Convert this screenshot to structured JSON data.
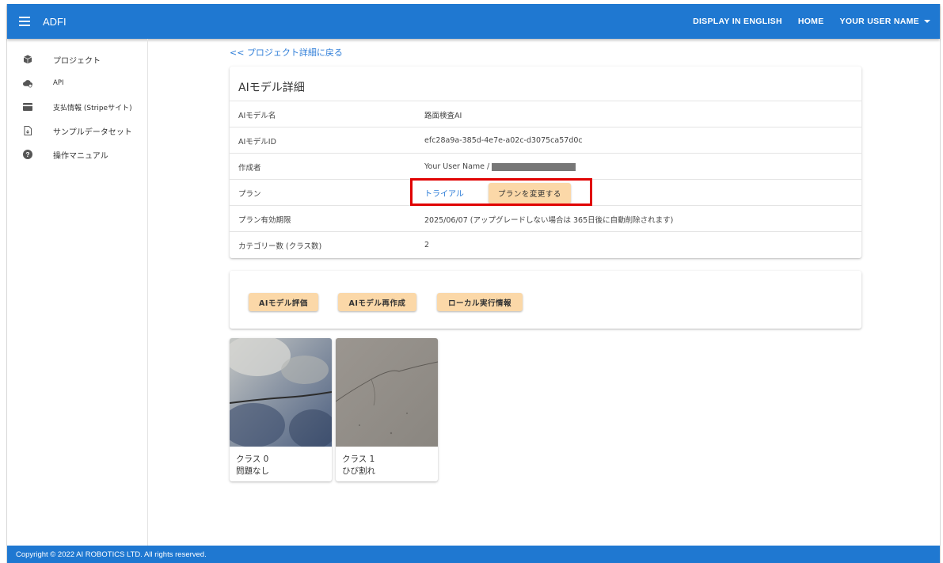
{
  "appbar": {
    "title": "ADFI",
    "lang_link": "DISPLAY IN ENGLISH",
    "home_link": "HOME",
    "user_menu": "YOUR USER NAME"
  },
  "sidebar": {
    "items": [
      {
        "label": "プロジェクト",
        "icon": "cube-icon"
      },
      {
        "label": "API",
        "icon": "cloud-api-icon"
      },
      {
        "label": "支払情報 (Stripeサイト)",
        "icon": "credit-card-icon"
      },
      {
        "label": "サンプルデータセット",
        "icon": "file-download-icon"
      },
      {
        "label": "操作マニュアル",
        "icon": "help-circle-icon"
      }
    ]
  },
  "back_link": "<< プロジェクト詳細に戻る",
  "detail": {
    "title": "AIモデル詳細",
    "rows": [
      {
        "label": "AIモデル名",
        "value": "路面検査AI"
      },
      {
        "label": "AIモデルID",
        "value": "efc28a9a-385d-4e7e-a02c-d3075ca57d0c"
      },
      {
        "label": "作成者",
        "value": "Your User Name /"
      },
      {
        "label": "プラン",
        "value": "トライアル",
        "button": "プランを変更する"
      },
      {
        "label": "プラン有効期限",
        "value": "2025/06/07 (アップグレードしない場合は 365日後に自動削除されます)"
      },
      {
        "label": "カテゴリー数 (クラス数)",
        "value": "2"
      }
    ]
  },
  "actions": {
    "evaluate": "AIモデル評価",
    "recreate": "AIモデル再作成",
    "local_info": "ローカル実行情報"
  },
  "classes": [
    {
      "id": "クラス 0",
      "name": "問題なし"
    },
    {
      "id": "クラス 1",
      "name": "ひび割れ"
    }
  ],
  "footer": "Copyright © 2022 AI ROBOTICS LTD. All rights reserved.",
  "colors": {
    "primary": "#1f78d1",
    "button": "#fbd8a8",
    "link": "#2f7ed8",
    "highlight": "#e00000"
  }
}
